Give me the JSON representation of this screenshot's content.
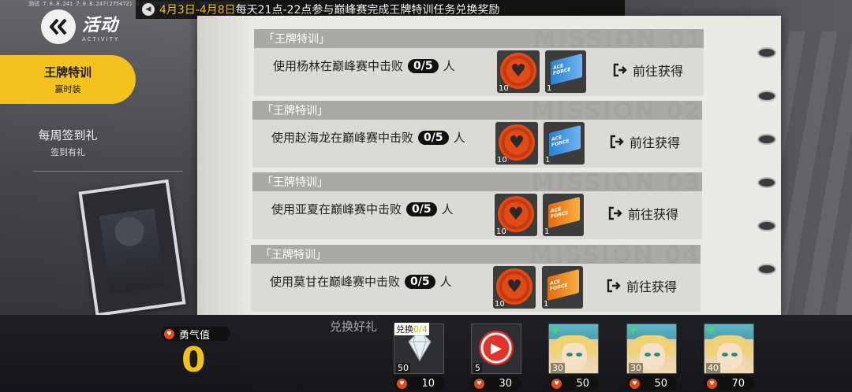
{
  "status_bar": "测试 7.0.8.241 7.0.8.247(275472) 0 9986505071000121 0403205740|2057",
  "announcement": {
    "dates": "4月3日-4月8日",
    "text": "每天21点-22点参与巅峰赛完成王牌特训任务兑换奖励"
  },
  "header": {
    "title": "活动",
    "subtitle": "ACTIVITY"
  },
  "tabs": [
    {
      "label": "王牌特训",
      "sub": "赢时装"
    },
    {
      "label": "每周签到礼",
      "sub": "签到有礼"
    }
  ],
  "missions": [
    {
      "header": "「王牌特训」",
      "prefix": "使用杨林在巅峰赛中击败",
      "progress": "0/5",
      "unit": "人",
      "watermark": "MISSION 01",
      "reward1_count": "10",
      "reward2_count": "1",
      "ticket": "blue",
      "go_label": "前往获得"
    },
    {
      "header": "「王牌特训」",
      "prefix": "使用赵海龙在巅峰赛中击败",
      "progress": "0/5",
      "unit": "人",
      "watermark": "MISSION 02",
      "reward1_count": "10",
      "reward2_count": "1",
      "ticket": "blue",
      "go_label": "前往获得"
    },
    {
      "header": "「王牌特训」",
      "prefix": "使用亚夏在巅峰赛中击败",
      "progress": "0/5",
      "unit": "人",
      "watermark": "MISSION 03",
      "reward1_count": "10",
      "reward2_count": "1",
      "ticket": "orange",
      "go_label": "前往获得"
    },
    {
      "header": "「王牌特训」",
      "prefix": "使用莫甘在巅峰赛中击败",
      "progress": "0/5",
      "unit": "人",
      "watermark": "MISSION 04",
      "reward1_count": "10",
      "reward2_count": "1",
      "ticket": "orange",
      "go_label": "前往获得"
    }
  ],
  "ticket_text": "ACE FORCE",
  "courage": {
    "label": "勇气值",
    "value": "0"
  },
  "exchange": {
    "title": "兑换好礼",
    "limit_label": "兑换",
    "limit_value": "0/4",
    "items": [
      {
        "kind": "diamond",
        "count": "50",
        "cost": "10"
      },
      {
        "kind": "red-coin",
        "count": "5",
        "cost": "30"
      },
      {
        "kind": "avatar",
        "count": "30",
        "cost": "50"
      },
      {
        "kind": "avatar",
        "count": "30",
        "cost": "50"
      },
      {
        "kind": "avatar",
        "count": "40",
        "cost": "70"
      }
    ]
  },
  "colors": {
    "accent": "#f4c21e",
    "orange": "#e24a16"
  }
}
